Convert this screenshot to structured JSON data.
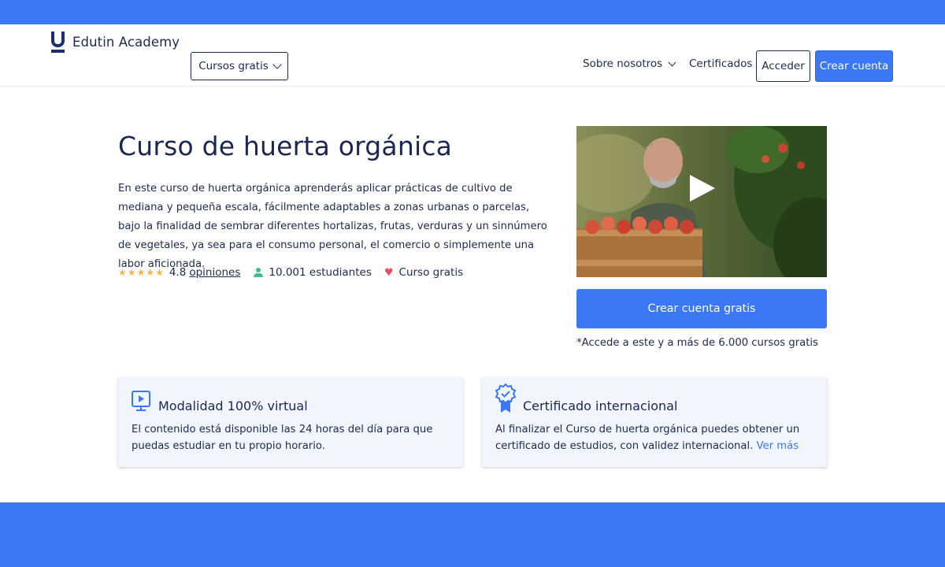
{
  "header": {
    "logo_text": "Edutin Academy",
    "courses_label": "Cursos gratis",
    "about_label": "Sobre nosotros",
    "certificates_label": "Certificados",
    "login_label": "Acceder",
    "signup_label": "Crear cuenta"
  },
  "course": {
    "title": "Curso de huerta orgánica",
    "description": "En este curso de huerta orgánica aprenderás aplicar prácticas de cultivo de mediana y pequeña escala, fácilmente adaptables a zonas urbanas o parcelas, bajo la finalidad de sembrar diferentes hortalizas, frutas, verduras y un sinnúmero de vegetales, ya sea para el consumo personal, el comercio o simplemente una labor aficionada.",
    "rating": "4.8",
    "rating_stars": 5,
    "opinions_label": "opiniones",
    "students": "10.001 estudiantes",
    "price_label": "Curso gratis"
  },
  "cta": {
    "button_label": "Crear cuenta gratis",
    "note": "*Accede a este y a más de 6.000 cursos gratis"
  },
  "cards": [
    {
      "icon": "monitor-play-icon",
      "title": "Modalidad 100% virtual",
      "text": "El contenido está disponible las 24 horas del día para que puedas estudiar en tu propio horario."
    },
    {
      "icon": "certificate-badge-icon",
      "title": "Certificado internacional",
      "text": "Al finalizar el Curso de huerta orgánica puedes obtener un certificado de estudios, con validez internacional.",
      "link_label": "Ver más"
    }
  ],
  "colors": {
    "brand_blue": "#3b78f5",
    "navy_text": "#1d2a4d",
    "star": "#f4b73f",
    "heart": "#e35360",
    "user": "#49b98f",
    "card_bg": "#f1f6fc"
  }
}
